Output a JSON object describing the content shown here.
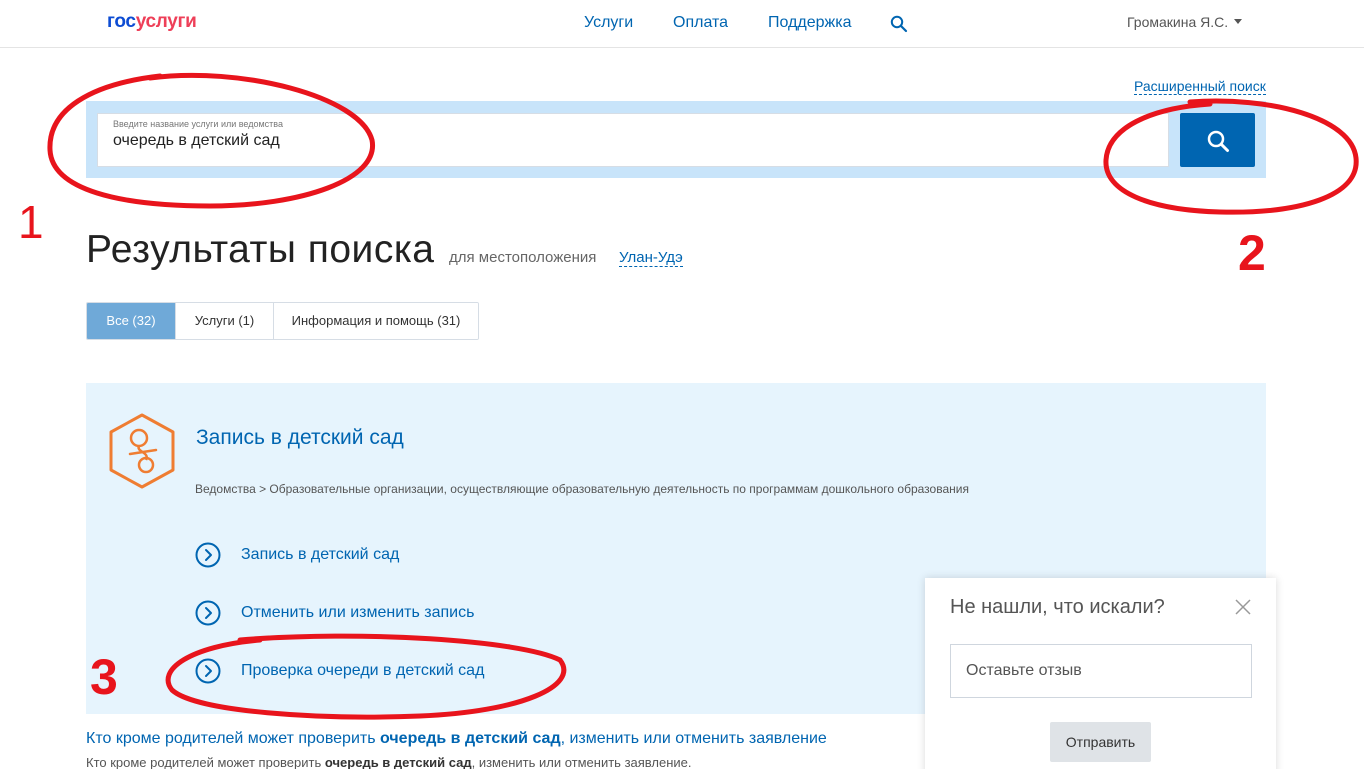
{
  "header": {
    "logo_part1": "гос",
    "logo_part2": "услуги",
    "nav": [
      {
        "label": "Услуги"
      },
      {
        "label": "Оплата"
      },
      {
        "label": "Поддержка"
      }
    ],
    "user_name": "Громакина Я.С."
  },
  "search": {
    "advanced_link": "Расширенный поиск",
    "hint": "Введите название услуги или ведомства",
    "value": "очередь в детский сад"
  },
  "results": {
    "title": "Результаты поиска",
    "for_location": "для местоположения",
    "city": "Улан-Удэ",
    "tabs": [
      {
        "label": "Все (32)",
        "active": true
      },
      {
        "label": "Услуги (1)",
        "active": false
      },
      {
        "label": "Информация и помощь (31)",
        "active": false
      }
    ]
  },
  "card": {
    "title": "Запись в детский сад",
    "path": "Ведомства > Образовательные организации, осуществляющие образовательную деятельность по программам дошкольного образования",
    "links": [
      {
        "label": "Запись в детский сад"
      },
      {
        "label": "Отменить или изменить запись"
      },
      {
        "label": "Проверка очереди в детский сад"
      }
    ]
  },
  "info_result": {
    "title_before": "Кто кроме родителей может проверить ",
    "title_bold": "очередь в детский сад",
    "title_after": ", изменить или отменить заявление",
    "snippet_before": "Кто кроме родителей может проверить ",
    "snippet_bold": "очередь в детский сад",
    "snippet_after": ", изменить или отменить заявление."
  },
  "feedback": {
    "title": "Не нашли, что искали?",
    "input_placeholder": "Оставьте отзыв",
    "submit_label": "Отправить"
  },
  "annotations": {
    "n1": "1",
    "n2": "2",
    "n3": "3"
  },
  "colors": {
    "brand_blue": "#0065b1",
    "logo_red": "#ee3f58",
    "annotation_red": "#e8141c",
    "icon_orange": "#ef7d32"
  }
}
